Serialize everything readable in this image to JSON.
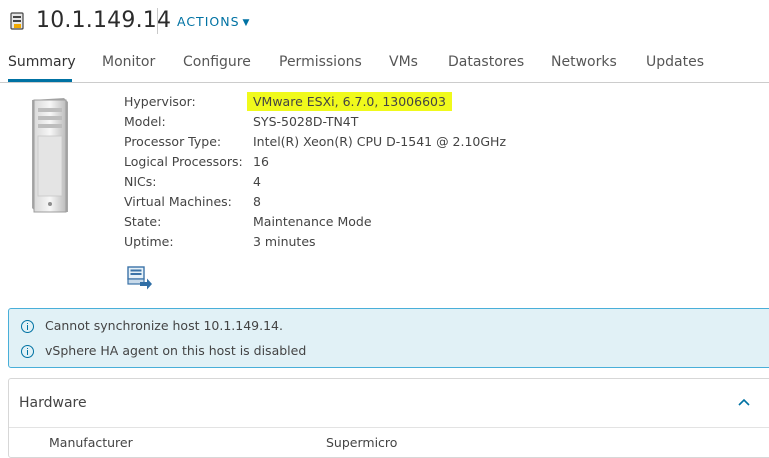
{
  "header": {
    "title": "10.1.149.14",
    "actions_label": "ACTIONS"
  },
  "tabs": [
    {
      "label": "Summary"
    },
    {
      "label": "Monitor"
    },
    {
      "label": "Configure"
    },
    {
      "label": "Permissions"
    },
    {
      "label": "VMs"
    },
    {
      "label": "Datastores"
    },
    {
      "label": "Networks"
    },
    {
      "label": "Updates"
    }
  ],
  "active_tab": "Summary",
  "summary": {
    "properties": [
      {
        "label": "Hypervisor:",
        "value": "VMware ESXi, 6.7.0, 13006603",
        "highlighted": true
      },
      {
        "label": "Model:",
        "value": "SYS-5028D-TN4T"
      },
      {
        "label": "Processor Type:",
        "value": "Intel(R) Xeon(R) CPU D-1541 @ 2.10GHz"
      },
      {
        "label": "Logical Processors:",
        "value": "16"
      },
      {
        "label": "NICs:",
        "value": "4"
      },
      {
        "label": "Virtual Machines:",
        "value": "8"
      },
      {
        "label": "State:",
        "value": "Maintenance Mode"
      },
      {
        "label": "Uptime:",
        "value": "3 minutes"
      }
    ]
  },
  "alerts": [
    {
      "text": "Cannot synchronize host 10.1.149.14."
    },
    {
      "text": "vSphere HA agent on this host is disabled"
    }
  ],
  "hardware": {
    "title": "Hardware",
    "rows": [
      {
        "label": "Manufacturer",
        "value": "Supermicro"
      }
    ]
  },
  "icons": {
    "host": "host-icon",
    "actions_caret": "chevron-down-icon",
    "server": "server-image",
    "host_console": "host-console-icon",
    "info": "info-icon",
    "collapse": "chevron-up-icon"
  },
  "colors": {
    "accent": "#0072a3",
    "highlight": "#f0fa1c",
    "alert_bg": "#e1f1f6",
    "alert_border": "#49afd9"
  }
}
